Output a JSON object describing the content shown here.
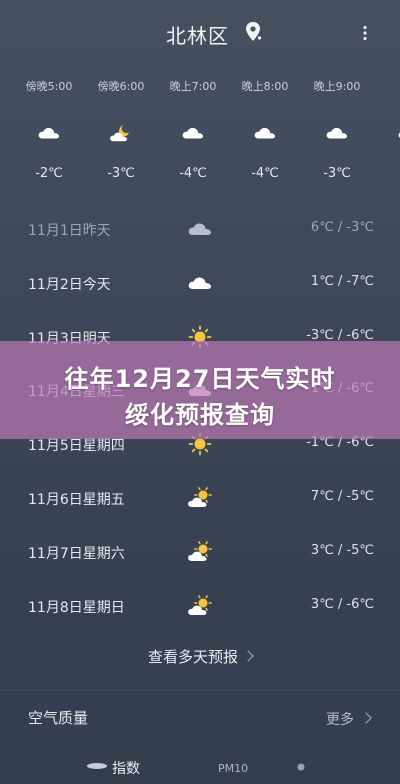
{
  "header": {
    "city": "北林区",
    "location_icon": "location-pin-icon",
    "more_icon": "more-vertical-icon"
  },
  "hourly": [
    {
      "time": "傍晚5:00",
      "icon": "cloudy",
      "temp": "-2℃"
    },
    {
      "time": "傍晚6:00",
      "icon": "night-partly-cloudy",
      "temp": "-3℃"
    },
    {
      "time": "晚上7:00",
      "icon": "cloudy",
      "temp": "-4℃"
    },
    {
      "time": "晚上8:00",
      "icon": "cloudy",
      "temp": "-4℃"
    },
    {
      "time": "晚上9:00",
      "icon": "cloudy",
      "temp": "-3℃"
    },
    {
      "time": "晚",
      "icon": "cloudy",
      "temp": ""
    }
  ],
  "daily": [
    {
      "label": "11月1日昨天",
      "icon": "cloudy",
      "range": "6℃ / -3℃",
      "past": true
    },
    {
      "label": "11月2日今天",
      "icon": "cloudy",
      "range": "1℃ / -7℃",
      "past": false
    },
    {
      "label": "11月3日明天",
      "icon": "sunny",
      "range": "-3℃ / -6℃",
      "past": false
    },
    {
      "label": "11月4日星期三",
      "icon": "cloudy",
      "range": "-1℃ / -6℃",
      "past": false
    },
    {
      "label": "11月5日星期四",
      "icon": "sunny",
      "range": "-1℃ / -6℃",
      "past": false
    },
    {
      "label": "11月6日星期五",
      "icon": "partly-cloudy",
      "range": "7℃ / -5℃",
      "past": false
    },
    {
      "label": "11月7日星期六",
      "icon": "partly-cloudy",
      "range": "3℃ / -5℃",
      "past": false
    },
    {
      "label": "11月8日星期日",
      "icon": "partly-cloudy",
      "range": "3℃ / -6℃",
      "past": false
    }
  ],
  "forecast_link": "查看多天预报",
  "air_quality": {
    "title": "空气质量",
    "more": "更多"
  },
  "bottom_bar": {
    "index_label": "指数",
    "pm_label": "PM10"
  },
  "banner": {
    "line1": "往年12月27日天气实时",
    "line2": "绥化预报查询"
  },
  "colors": {
    "background_top": "#46505f",
    "background_bottom": "#343d4c",
    "banner": "#b978b4",
    "sun": "#f5c542"
  }
}
